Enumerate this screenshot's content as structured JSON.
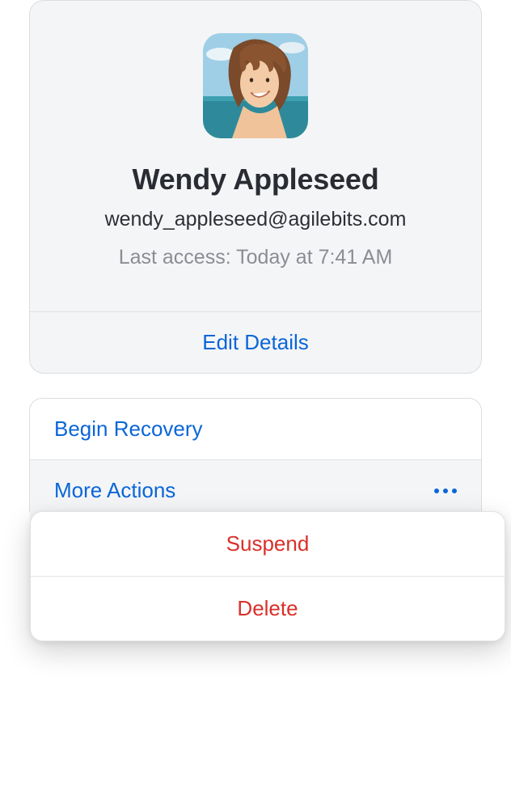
{
  "profile": {
    "name": "Wendy Appleseed",
    "email": "wendy_appleseed@agilebits.com",
    "last_access": "Last access: Today at 7:41 AM",
    "edit_label": "Edit Details"
  },
  "actions": {
    "begin_recovery": "Begin Recovery",
    "more_actions": "More Actions",
    "popover": {
      "suspend": "Suspend",
      "delete": "Delete"
    }
  },
  "colors": {
    "link": "#0a66d8",
    "destructive": "#d9302a",
    "muted": "#8b8d94"
  }
}
